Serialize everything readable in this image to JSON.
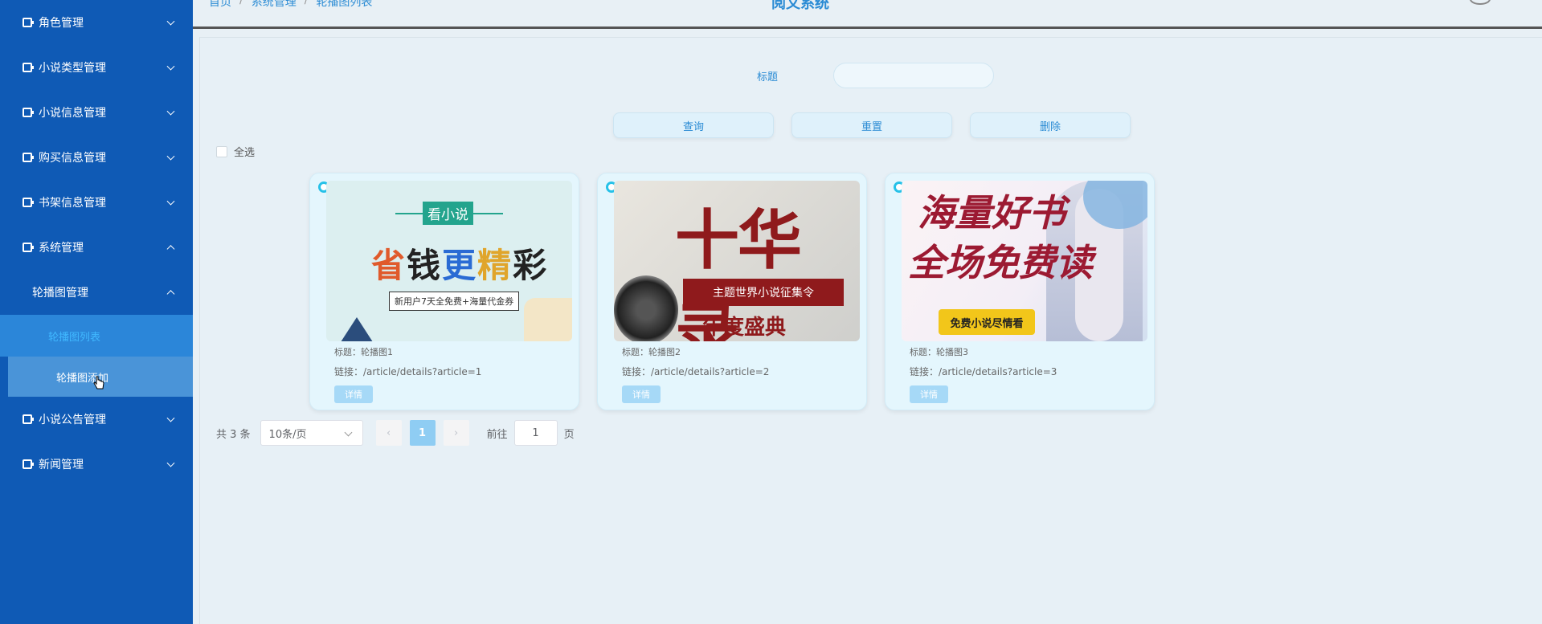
{
  "header": {
    "breadcrumb": [
      "首页",
      "系统管理",
      "轮播图列表"
    ],
    "brand": "阅文系统"
  },
  "sidebar": {
    "items": [
      {
        "label": "角色管理"
      },
      {
        "label": "小说类型管理"
      },
      {
        "label": "小说信息管理"
      },
      {
        "label": "购买信息管理"
      },
      {
        "label": "书架信息管理"
      },
      {
        "label": "系统管理"
      }
    ],
    "submenu_title": "轮播图管理",
    "submenu_items": [
      "轮播图列表",
      "轮播图添加"
    ],
    "bottom_items": [
      {
        "label": "小说公告管理"
      },
      {
        "label": "新闻管理"
      }
    ]
  },
  "search": {
    "label": "标题",
    "value": ""
  },
  "buttons": {
    "query": "查询",
    "reset": "重置",
    "delete": "删除"
  },
  "select_all": "全选",
  "cards": [
    {
      "title": "标题：轮播图1",
      "link": "链接：/article/details?article=1",
      "detail": "详情",
      "image_text": {
        "top": "看小说",
        "main": [
          "省",
          "钱",
          "更",
          "精",
          "彩"
        ],
        "sub": "新用户7天全免费+海量代金券"
      }
    },
    {
      "title": "标题：轮播图2",
      "link": "链接：/article/details?article=2",
      "detail": "详情",
      "image_text": {
        "main": "十华录",
        "banner": "主题世界小说征集令",
        "bottom": "年度盛典"
      }
    },
    {
      "title": "标题：轮播图3",
      "link": "链接：/article/details?article=3",
      "detail": "详情",
      "image_text": {
        "line1": "海量好书",
        "line2": "全场免费读",
        "button": "免费小说尽情看"
      }
    }
  ],
  "pagination": {
    "total": "共 3 条",
    "page_size": "10条/页",
    "prev": "‹",
    "current": "1",
    "next": "›",
    "goto_label": "前往",
    "goto_value": "1",
    "page_unit": "页"
  },
  "colors": {
    "sidebar_bg": "#0f5ab5",
    "accent": "#2a8bd4",
    "card_bg": "#e4f6fd",
    "radio": "#26c1e8"
  }
}
